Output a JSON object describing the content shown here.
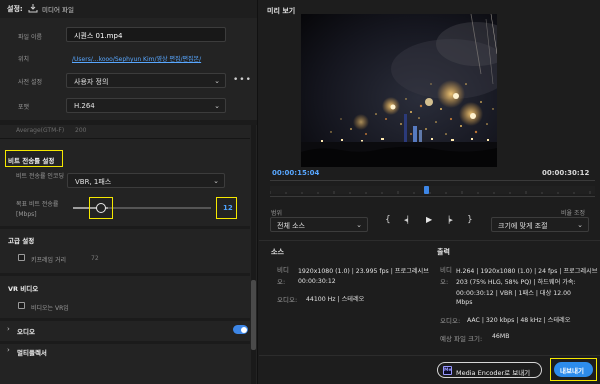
{
  "left": {
    "header": {
      "title": "설정:",
      "icon": "export-icon",
      "subtitle": "미디어 파일"
    },
    "file_name": {
      "label": "파일 이름",
      "value": "시퀀스 01.mp4"
    },
    "location": {
      "label": "위치",
      "value": "/Users/...kooo/Sephyun Kim/영상 편집/편집본/"
    },
    "preset": {
      "label": "사전 설정",
      "value": "사용자 정의"
    },
    "format": {
      "label": "포맷",
      "value": "H.264"
    },
    "partial": {
      "label": "Average(GTM-F)",
      "value": "200"
    },
    "bitrate": {
      "title": "비트 전송률 설정",
      "encoding": {
        "label": "비트 전송률 인코딩",
        "value": "VBR, 1패스"
      },
      "target": {
        "label": "목표 비트 전송률 [Mbps]",
        "value": "12",
        "level": 0.25
      }
    },
    "advanced": {
      "title": "고급 설정",
      "keyframe": {
        "label": "키프레임 거리",
        "value": "72"
      }
    },
    "vr": {
      "title": "VR 비디오",
      "checkbox_label": "비디오는 VR임"
    },
    "audio": {
      "title": "오디오"
    },
    "multiplexer": {
      "title": "멀티플렉서"
    }
  },
  "right": {
    "preview_title": "미리 보기",
    "timecode_current": "00:00:15:04",
    "timecode_end": "00:00:30:12",
    "range": {
      "label": "범위",
      "value": "전체 소스"
    },
    "scale": {
      "label": "비율 조정",
      "value": "크기에 맞게 조절"
    },
    "source": {
      "title": "소스",
      "video_label": "비디오:",
      "video_value": "1920x1080 (1.0)  |  23.995 fps  |  프로그레시브",
      "video_duration": "00:00:30:12",
      "audio_label": "오디오:",
      "audio_value": "44100 Hz  |  스테레오"
    },
    "output": {
      "title": "출력",
      "video_label": "비디오:",
      "video_lines": [
        "H.264  |  1920x1080 (1.0)  |  24 fps  |  프로그레시브",
        "203 (75% HLG, 58% PQ)  |  하드웨어 가속:  00:00:30:12  |  VBR  |  1패스  |  대상 12.00",
        "Mbps"
      ],
      "audio_label": "오디오:",
      "audio_value": "AAC  |  320 kbps  |  48 kHz  |  스테레오",
      "size_label": "예상 파일 크기:",
      "size_value": "46MB"
    },
    "media_encoder_button": "Media Encoder로 보내기",
    "media_encoder_badge": "Me",
    "export_button": "내보내기"
  },
  "colors": {
    "highlight": "#f5e800",
    "accent_blue": "#2d8ceb",
    "timecode_blue": "#58a7ff",
    "toggle_on": "#3d86e6"
  }
}
